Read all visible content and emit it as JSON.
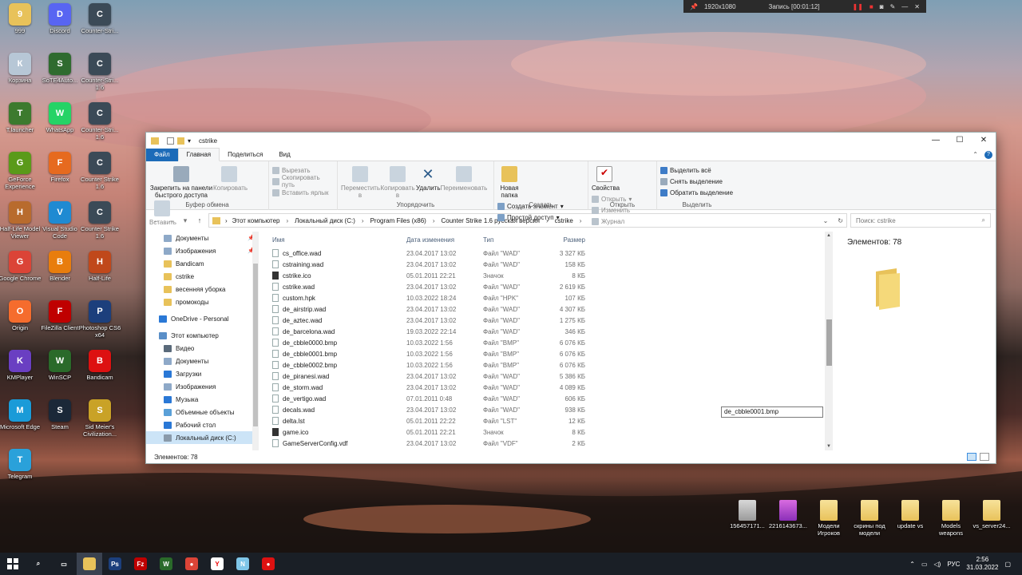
{
  "recorder": {
    "resolution": "1920x1080",
    "recording": "Запись [00:01:12]"
  },
  "desktop_left": [
    {
      "label": "999",
      "icon": "folder-icon",
      "color": "#e8c25a"
    },
    {
      "label": "Discord",
      "icon": "discord-icon",
      "color": "#5865f2"
    },
    {
      "label": "Counter-Stri...",
      "icon": "counter-strike-icon",
      "color": "#3b4a57"
    },
    {
      "label": "Корзина",
      "icon": "recycle-bin-icon",
      "color": "#b7c7d6"
    },
    {
      "label": "SoTE4Auto...",
      "icon": "app-icon",
      "color": "#2f6b2f"
    },
    {
      "label": "Counter-Stri... 1.6",
      "icon": "counter-strike-icon",
      "color": "#3b4a57"
    },
    {
      "label": "T.launcher",
      "icon": "tlauncher-icon",
      "color": "#3c7a2e"
    },
    {
      "label": "WhatsApp",
      "icon": "whatsapp-icon",
      "color": "#25d366"
    },
    {
      "label": "Counter-Stri... 1.6",
      "icon": "counter-strike-icon",
      "color": "#3b4a57"
    },
    {
      "label": "GeForce Experience",
      "icon": "geforce-icon",
      "color": "#5a9a1a"
    },
    {
      "label": "Firefox",
      "icon": "firefox-icon",
      "color": "#e66a1f"
    },
    {
      "label": "Counter Strike 1.6",
      "icon": "counter-strike-icon",
      "color": "#3b4a57"
    },
    {
      "label": "Half-Life Model Viewer",
      "icon": "hlmv-icon",
      "color": "#b86b2d"
    },
    {
      "label": "Visual Studio Code",
      "icon": "vscode-icon",
      "color": "#1f8ad2"
    },
    {
      "label": "Counter Strike 1.6",
      "icon": "counter-strike-icon",
      "color": "#3b4a57"
    },
    {
      "label": "Google Chrome",
      "icon": "chrome-icon",
      "color": "#db4437"
    },
    {
      "label": "Blender",
      "icon": "blender-icon",
      "color": "#e87d0d"
    },
    {
      "label": "Half-Life",
      "icon": "half-life-icon",
      "color": "#c0481b"
    },
    {
      "label": "Origin",
      "icon": "origin-icon",
      "color": "#f56c2d"
    },
    {
      "label": "FileZilla Client",
      "icon": "filezilla-icon",
      "color": "#bf0000"
    },
    {
      "label": "Photoshop CS6 x64",
      "icon": "photoshop-icon",
      "color": "#1c3f7c"
    },
    {
      "label": "KMPlayer",
      "icon": "kmplayer-icon",
      "color": "#6a3fc2"
    },
    {
      "label": "WinSCP",
      "icon": "winscp-icon",
      "color": "#2a6a2a"
    },
    {
      "label": "Bandicam",
      "icon": "bandicam-icon",
      "color": "#d11"
    },
    {
      "label": "Microsoft Edge",
      "icon": "edge-icon",
      "color": "#1a9bd8"
    },
    {
      "label": "Steam",
      "icon": "steam-icon",
      "color": "#1b2838"
    },
    {
      "label": "Sid Meier's Civilization...",
      "icon": "civilization-icon",
      "color": "#c9a227"
    },
    {
      "label": "Telegram",
      "icon": "telegram-icon",
      "color": "#2aa1da"
    }
  ],
  "window": {
    "title": "cstrike",
    "tabs": [
      "Файл",
      "Главная",
      "Поделиться",
      "Вид"
    ],
    "ribbon": {
      "clipboard": {
        "name": "Буфер обмена",
        "pin": "Закрепить на панели быстрого доступа",
        "copy": "Копировать",
        "paste": "Вставить",
        "cut": "Вырезать",
        "copy_path": "Скопировать путь",
        "paste_shortcut": "Вставить ярлык"
      },
      "organize": {
        "name": "Упорядочить",
        "move": "Переместить в",
        "copyto": "Копировать в",
        "delete": "Удалить",
        "rename": "Переименовать"
      },
      "create": {
        "name": "Создать",
        "new_folder": "Новая папка",
        "new_item": "Создать элемент",
        "easy_access": "Простой доступ"
      },
      "open": {
        "name": "Открыть",
        "properties": "Свойства",
        "open": "Открыть",
        "edit": "Изменить",
        "history": "Журнал"
      },
      "select": {
        "name": "Выделить",
        "all": "Выделить всё",
        "none": "Снять выделение",
        "invert": "Обратить выделение"
      }
    },
    "breadcrumb": [
      "Этот компьютер",
      "Локальный диск (C:)",
      "Program Files (x86)",
      "Counter Strike 1.6 русская версия",
      "cstrike"
    ],
    "search_placeholder": "Поиск: cstrike",
    "nav": [
      {
        "label": "Документы",
        "pinned": true,
        "color": "#8ea9c8"
      },
      {
        "label": "Изображения",
        "pinned": true,
        "color": "#8ea9c8"
      },
      {
        "label": "Bandicam",
        "pinned": false,
        "color": "#e8c25a"
      },
      {
        "label": "cstrike",
        "pinned": false,
        "color": "#e8c25a"
      },
      {
        "label": "весенняя уборка",
        "pinned": false,
        "color": "#e8c25a"
      },
      {
        "label": "промокоды",
        "pinned": false,
        "color": "#e8c25a"
      },
      {
        "label": "OneDrive - Personal",
        "pinned": false,
        "color": "#2a78d6"
      },
      {
        "label": "Этот компьютер",
        "pinned": false,
        "color": "#5a8fc8"
      },
      {
        "label": "Видео",
        "pinned": false,
        "color": "#5a6a7a"
      },
      {
        "label": "Документы",
        "pinned": false,
        "color": "#8ea9c8"
      },
      {
        "label": "Загрузки",
        "pinned": false,
        "color": "#2a78d6"
      },
      {
        "label": "Изображения",
        "pinned": false,
        "color": "#8ea9c8"
      },
      {
        "label": "Музыка",
        "pinned": false,
        "color": "#2a78d6"
      },
      {
        "label": "Объемные объекты",
        "pinned": false,
        "color": "#5aa0d8"
      },
      {
        "label": "Рабочий стол",
        "pinned": false,
        "color": "#2a78d6"
      },
      {
        "label": "Локальный диск (C:)",
        "pinned": false,
        "color": "#8a9aaa"
      }
    ],
    "columns": [
      "Имя",
      "Дата изменения",
      "Тип",
      "Размер"
    ],
    "files": [
      {
        "name": "cs_office.wad",
        "date": "23.04.2017 13:02",
        "type": "Файл \"WAD\"",
        "size": "3 327 КБ"
      },
      {
        "name": "cstraining.wad",
        "date": "23.04.2017 13:02",
        "type": "Файл \"WAD\"",
        "size": "158 КБ"
      },
      {
        "name": "cstrike.ico",
        "date": "05.01.2011 22:21",
        "type": "Значок",
        "size": "8 КБ",
        "cs": true
      },
      {
        "name": "cstrike.wad",
        "date": "23.04.2017 13:02",
        "type": "Файл \"WAD\"",
        "size": "2 619 КБ"
      },
      {
        "name": "custom.hpk",
        "date": "10.03.2022 18:24",
        "type": "Файл \"HPK\"",
        "size": "107 КБ"
      },
      {
        "name": "de_airstrip.wad",
        "date": "23.04.2017 13:02",
        "type": "Файл \"WAD\"",
        "size": "4 307 КБ"
      },
      {
        "name": "de_aztec.wad",
        "date": "23.04.2017 13:02",
        "type": "Файл \"WAD\"",
        "size": "1 275 КБ"
      },
      {
        "name": "de_barcelona.wad",
        "date": "19.03.2022 22:14",
        "type": "Файл \"WAD\"",
        "size": "346 КБ"
      },
      {
        "name": "de_cbble0000.bmp",
        "date": "10.03.2022 1:56",
        "type": "Файл \"BMP\"",
        "size": "6 076 КБ"
      },
      {
        "name": "de_cbble0001.bmp",
        "date": "10.03.2022 1:56",
        "type": "Файл \"BMP\"",
        "size": "6 076 КБ"
      },
      {
        "name": "de_cbble0002.bmp",
        "date": "10.03.2022 1:56",
        "type": "Файл \"BMP\"",
        "size": "6 076 КБ"
      },
      {
        "name": "de_piranesi.wad",
        "date": "23.04.2017 13:02",
        "type": "Файл \"WAD\"",
        "size": "5 386 КБ"
      },
      {
        "name": "de_storm.wad",
        "date": "23.04.2017 13:02",
        "type": "Файл \"WAD\"",
        "size": "4 089 КБ"
      },
      {
        "name": "de_vertigo.wad",
        "date": "07.01.2011 0:48",
        "type": "Файл \"WAD\"",
        "size": "606 КБ"
      },
      {
        "name": "decals.wad",
        "date": "23.04.2017 13:02",
        "type": "Файл \"WAD\"",
        "size": "938 КБ"
      },
      {
        "name": "delta.lst",
        "date": "05.01.2011 22:22",
        "type": "Файл \"LST\"",
        "size": "12 КБ"
      },
      {
        "name": "game.ico",
        "date": "05.01.2011 22:21",
        "type": "Значок",
        "size": "8 КБ",
        "cs": true
      },
      {
        "name": "GameServerConfig.vdf",
        "date": "23.04.2017 13:02",
        "type": "Файл \"VDF\"",
        "size": "2 КБ"
      }
    ],
    "rename_value": "de_cbble0001.bmp",
    "preview_count": "Элементов: 78",
    "status": "Элементов: 78"
  },
  "desktop_right": [
    {
      "label": "156457171...",
      "kind": "file"
    },
    {
      "label": "2216143673...",
      "kind": "image"
    },
    {
      "label": "Модели Игроков",
      "kind": "folder"
    },
    {
      "label": "скрины под модели",
      "kind": "folder"
    },
    {
      "label": "update vs",
      "kind": "folder"
    },
    {
      "label": "Models weapons",
      "kind": "folder"
    },
    {
      "label": "vs_server24...",
      "kind": "folder"
    }
  ],
  "taskbar": {
    "apps": [
      {
        "icon": "search-icon",
        "color": "#1a1f26",
        "glyph": "⌕"
      },
      {
        "icon": "task-view-icon",
        "color": "#1a1f26",
        "glyph": "▭"
      },
      {
        "icon": "file-explorer-icon",
        "color": "#e8c25a",
        "glyph": ""
      },
      {
        "icon": "photoshop-icon",
        "color": "#1c3f7c",
        "glyph": "Ps"
      },
      {
        "icon": "filezilla-icon",
        "color": "#bf0000",
        "glyph": "Fz"
      },
      {
        "icon": "winscp-icon",
        "color": "#2a6a2a",
        "glyph": "W"
      },
      {
        "icon": "chrome-icon",
        "color": "#db4437",
        "glyph": "●"
      },
      {
        "icon": "yandex-icon",
        "color": "#ffffff",
        "glyph": "Y"
      },
      {
        "icon": "notepad-icon",
        "color": "#7fc6e8",
        "glyph": "N"
      },
      {
        "icon": "bandicam-icon",
        "color": "#d11",
        "glyph": "●"
      }
    ],
    "lang": "РУС",
    "time": "2:56",
    "date": "31.03.2022"
  }
}
